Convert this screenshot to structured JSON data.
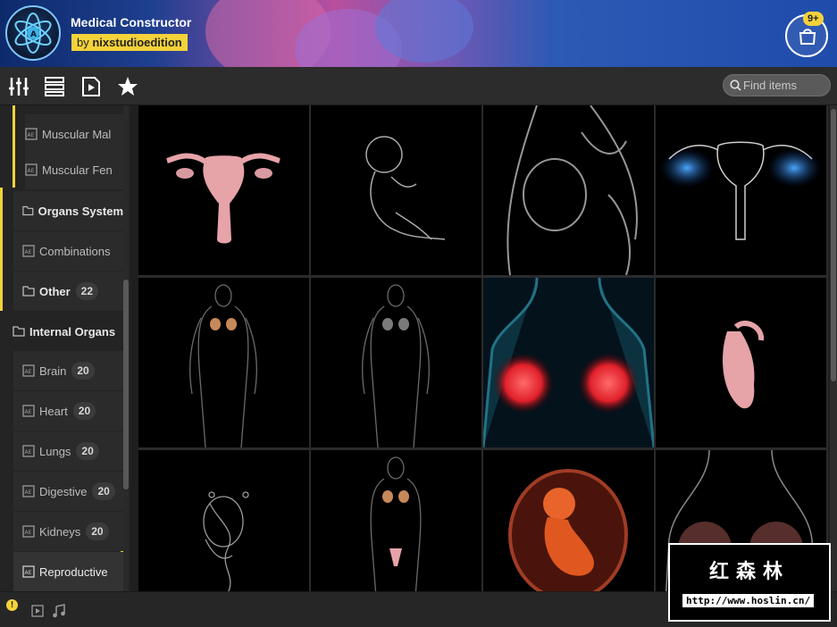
{
  "header": {
    "title": "Medical Constructor",
    "by_prefix": "by",
    "author": "nixstudioedition",
    "cart_badge": "9+"
  },
  "toolbar": {
    "icons": [
      "sliders-icon",
      "list-view-icon",
      "preview-icon",
      "star-icon"
    ],
    "search_placeholder": "Find items"
  },
  "sidebar": {
    "items": [
      {
        "label": "Muscular Mal",
        "count": ""
      },
      {
        "label": "Muscular Fen",
        "count": ""
      },
      {
        "label": "Organs System",
        "count": ""
      },
      {
        "label": "Combinations",
        "count": ""
      },
      {
        "label": "Other",
        "count": "22"
      },
      {
        "label": "Internal Organs",
        "count": ""
      },
      {
        "label": "Brain",
        "count": "20"
      },
      {
        "label": "Heart",
        "count": "20"
      },
      {
        "label": "Lungs",
        "count": "20"
      },
      {
        "label": "Digestive",
        "count": "20"
      },
      {
        "label": "Kidneys",
        "count": "20"
      },
      {
        "label": "Reproductive",
        "count": ""
      }
    ]
  },
  "grid": {
    "tiles": [
      "uterus",
      "fetus-outline",
      "pelvis-xray",
      "ovaries-glow",
      "body-mammary",
      "body-mammary-gray",
      "breast-glow-red",
      "uterus-side",
      "fetus-wire",
      "body-reproductive",
      "fetus-womb",
      "breast-glow"
    ]
  },
  "watermark": {
    "title": "红森林",
    "url": "http://www.hoslin.cn/"
  },
  "colors": {
    "accent": "#f3d23a",
    "sidebar_bg": "#242424",
    "toolbar_bg": "#2c2c2c"
  }
}
